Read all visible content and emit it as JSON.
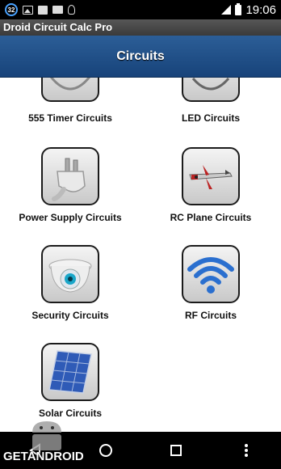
{
  "status_bar": {
    "notification_count": "32",
    "time": "19:06"
  },
  "app": {
    "title": "Droid Circuit Calc Pro"
  },
  "header": {
    "title": "Circuits"
  },
  "tiles": [
    {
      "label": "555 Timer Circuits",
      "icon": "timer-chip-icon"
    },
    {
      "label": "LED Circuits",
      "icon": "led-icon"
    },
    {
      "label": "Power Supply Circuits",
      "icon": "power-plug-icon"
    },
    {
      "label": "RC Plane Circuits",
      "icon": "rc-plane-icon"
    },
    {
      "label": "Security Circuits",
      "icon": "security-camera-icon"
    },
    {
      "label": "RF Circuits",
      "icon": "wifi-signal-icon"
    },
    {
      "label": "Solar Circuits",
      "icon": "solar-panel-icon"
    }
  ],
  "navigation": {
    "back": "back-icon",
    "home": "home-icon",
    "recents": "recents-icon",
    "menu": "overflow-menu-icon"
  },
  "watermark": {
    "text": "GETANDROID"
  },
  "colors": {
    "header_top": "#2c5e97",
    "header_bottom": "#17437a",
    "titlebar": "#4a4a4a",
    "rf_blue": "#2a6fcf"
  }
}
